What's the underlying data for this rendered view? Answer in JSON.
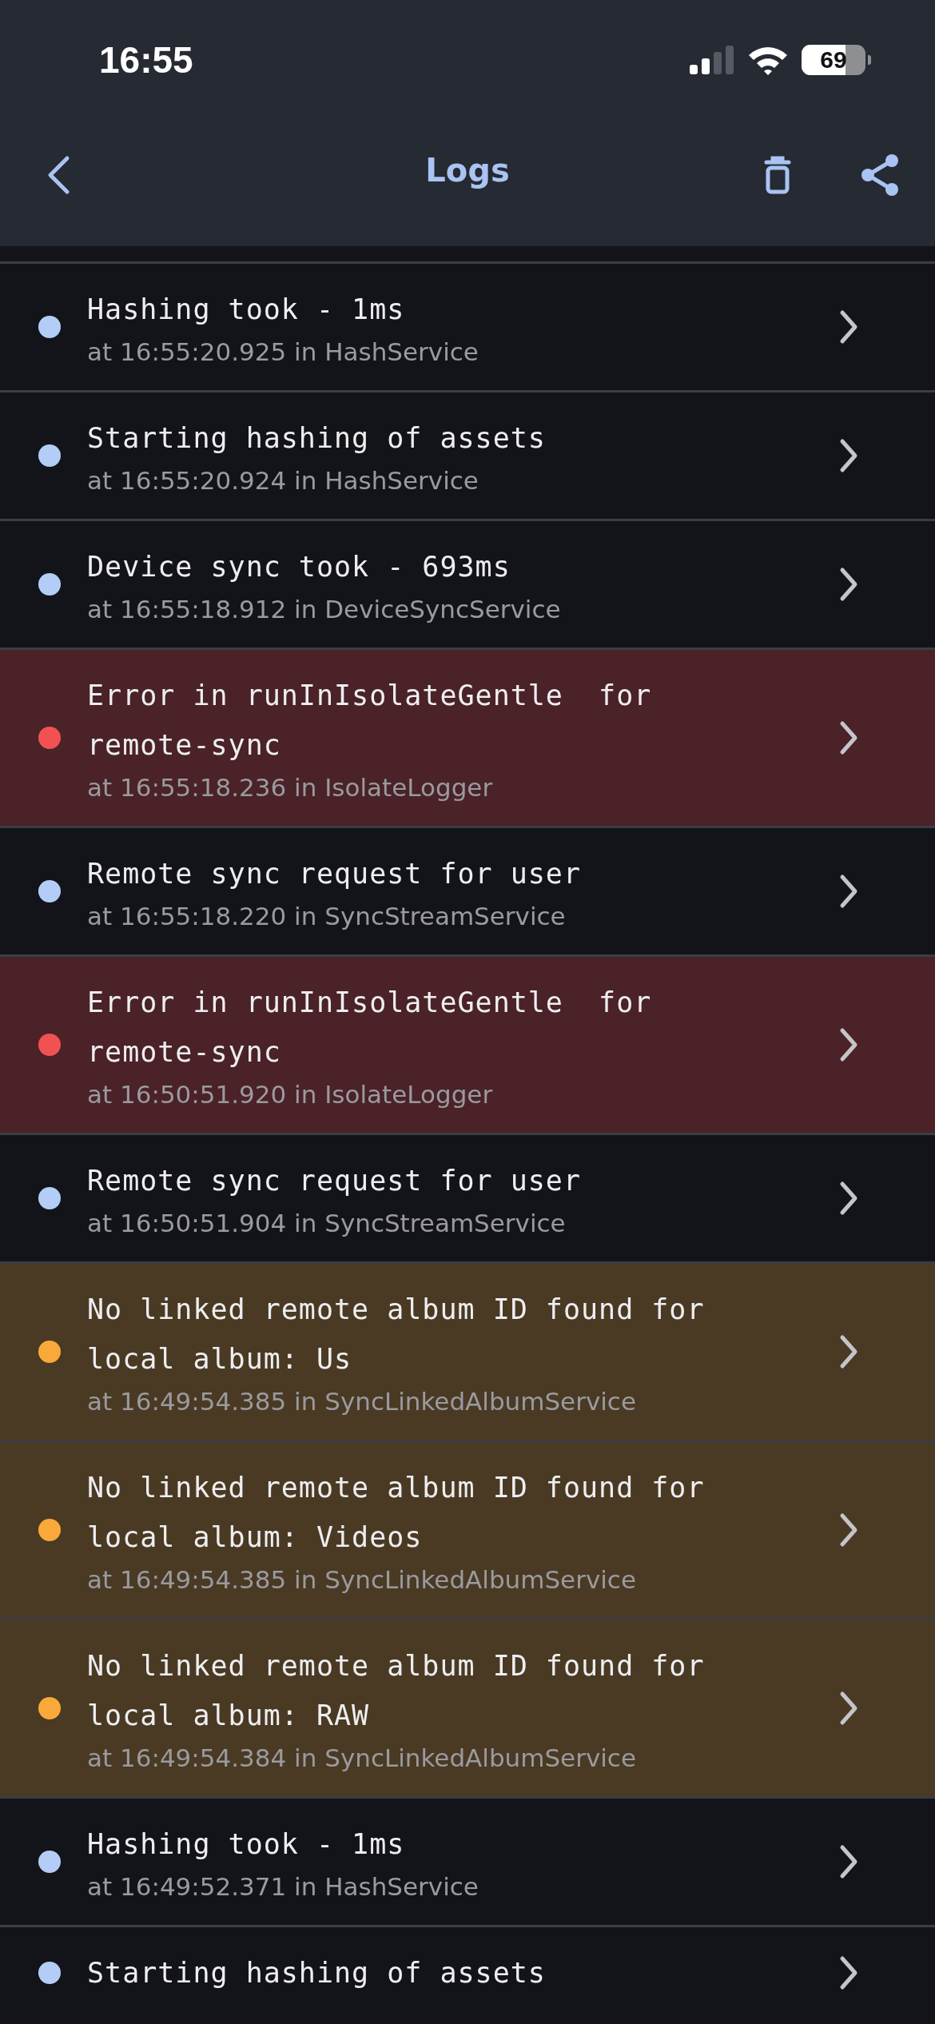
{
  "status_bar": {
    "time": "16:55",
    "battery": "69"
  },
  "header": {
    "title": "Logs"
  },
  "logs": [
    {
      "kind": "info",
      "color": "#b4cdf7",
      "message": "Hashing took - 1ms",
      "detail": "at 16:55:20.925 in HashService"
    },
    {
      "kind": "info",
      "color": "#b4cdf7",
      "message": "Starting hashing of assets",
      "detail": "at 16:55:20.924 in HashService"
    },
    {
      "kind": "info",
      "color": "#b4cdf7",
      "message": "Device sync took - 693ms",
      "detail": "at 16:55:18.912 in DeviceSyncService"
    },
    {
      "kind": "error",
      "color": "#f25151",
      "message": "Error in runInIsolateGentle  for remote-sync",
      "detail": "at 16:55:18.236 in IsolateLogger"
    },
    {
      "kind": "info",
      "color": "#b4cdf7",
      "message": "Remote sync request for user",
      "detail": "at 16:55:18.220 in SyncStreamService"
    },
    {
      "kind": "error",
      "color": "#f25151",
      "message": "Error in runInIsolateGentle  for remote-sync",
      "detail": "at 16:50:51.920 in IsolateLogger"
    },
    {
      "kind": "info",
      "color": "#b4cdf7",
      "message": "Remote sync request for user",
      "detail": "at 16:50:51.904 in SyncStreamService"
    },
    {
      "kind": "warning",
      "color": "#f9a93a",
      "message": "No linked remote album ID found for local album: Us",
      "detail": "at 16:49:54.385 in SyncLinkedAlbumService"
    },
    {
      "kind": "warning",
      "color": "#f9a93a",
      "message": "No linked remote album ID found for local album: Videos",
      "detail": "at 16:49:54.385 in SyncLinkedAlbumService"
    },
    {
      "kind": "warning",
      "color": "#f9a93a",
      "message": "No linked remote album ID found for local album: RAW",
      "detail": "at 16:49:54.384 in SyncLinkedAlbumService"
    },
    {
      "kind": "info",
      "color": "#b4cdf7",
      "message": "Hashing took - 1ms",
      "detail": "at 16:49:52.371 in HashService"
    },
    {
      "kind": "info",
      "color": "#b4cdf7",
      "message": "Starting hashing of assets"
    }
  ]
}
